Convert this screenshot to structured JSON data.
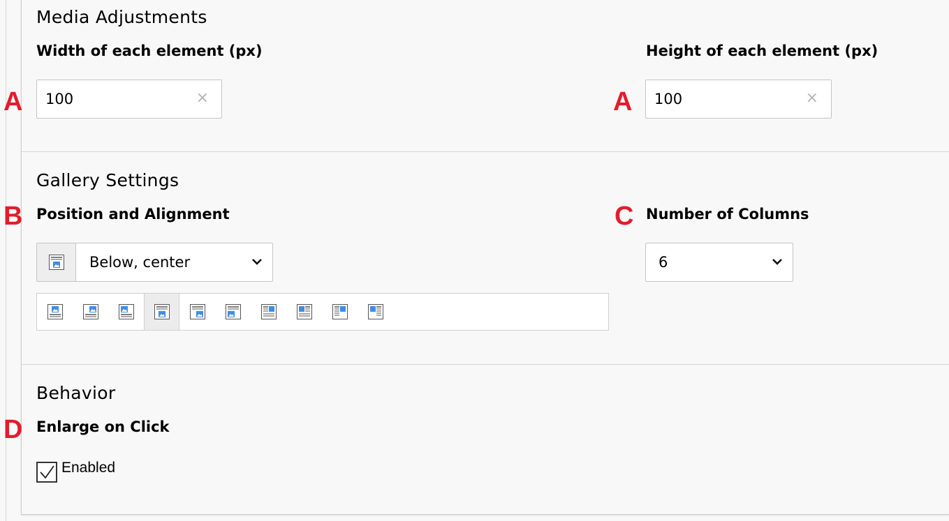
{
  "sections": {
    "media": {
      "title": "Media Adjustments",
      "width_label": "Width of each element (px)",
      "width_value": "100",
      "height_label": "Height of each element (px)",
      "height_value": "100",
      "clear_glyph": "×"
    },
    "gallery": {
      "title": "Gallery Settings",
      "position_label": "Position and Alignment",
      "position_value": "Below, center",
      "position_icon": "image-below-center-icon",
      "position_options": [
        {
          "name": "above-center-icon",
          "active": false
        },
        {
          "name": "above-right-icon",
          "active": false
        },
        {
          "name": "above-left-icon",
          "active": false
        },
        {
          "name": "below-center-icon",
          "active": true
        },
        {
          "name": "below-right-icon",
          "active": false
        },
        {
          "name": "below-left-icon",
          "active": false
        },
        {
          "name": "intext-right-wrap-icon",
          "active": false
        },
        {
          "name": "intext-left-wrap-icon",
          "active": false
        },
        {
          "name": "intext-right-nowrap-icon",
          "active": false
        },
        {
          "name": "intext-left-nowrap-icon",
          "active": false
        }
      ],
      "columns_label": "Number of Columns",
      "columns_value": "6"
    },
    "behavior": {
      "title": "Behavior",
      "enlarge_label": "Enlarge on Click",
      "enabled_label": "Enabled",
      "enabled_checked": true
    }
  },
  "annotations": [
    "A",
    "A",
    "B",
    "C",
    "D"
  ],
  "colors": {
    "annotation": "#e21d2c",
    "icon_blue": "#3d8ee8",
    "icon_line": "#555555"
  }
}
